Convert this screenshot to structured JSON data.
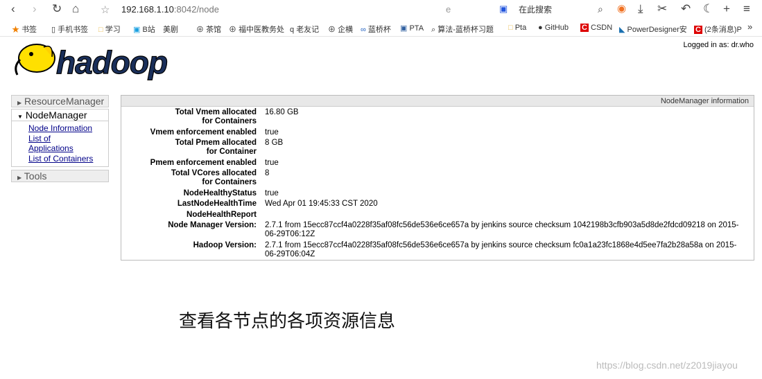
{
  "browser": {
    "url_host": "192.168.1.10",
    "url_rest": ":8042/node",
    "search_placeholder": "在此搜索",
    "bookmarks": [
      "书签",
      "手机书签",
      "学习",
      "B站",
      "美剧",
      "茶馆",
      "福中医教务处",
      "老友记",
      "企横",
      "蓝桥杯",
      "PTA",
      "算法-蓝桥杯习题",
      "Pta",
      "GitHub",
      "CSDN",
      "PowerDesigner安",
      "(2条消息)P"
    ]
  },
  "header": {
    "logo": "hadoop",
    "logged_in": "Logged in as: dr.who"
  },
  "sidebar": {
    "sections": [
      {
        "label": "ResourceManager"
      },
      {
        "label": "NodeManager",
        "items": [
          "Node Information",
          "List of Applications",
          "List of Containers"
        ]
      },
      {
        "label": "Tools"
      }
    ]
  },
  "main": {
    "title": "NodeManager information",
    "rows": [
      {
        "k": "Total Vmem allocated for Containers",
        "v": "16.80 GB"
      },
      {
        "k": "Vmem enforcement enabled",
        "v": "true"
      },
      {
        "k": "Total Pmem allocated for Container",
        "v": "8 GB"
      },
      {
        "k": "Pmem enforcement enabled",
        "v": "true"
      },
      {
        "k": "Total VCores allocated for Containers",
        "v": "8"
      },
      {
        "k": "NodeHealthyStatus",
        "v": "true"
      },
      {
        "k": "LastNodeHealthTime",
        "v": "Wed Apr 01 19:45:33 CST 2020"
      },
      {
        "k": "NodeHealthReport",
        "v": ""
      },
      {
        "k": "Node Manager Version:",
        "v": "2.7.1 from 15ecc87ccf4a0228f35af08fc56de536e6ce657a by jenkins source checksum 1042198b3cfb903a5d8de2fdcd09218 on 2015-06-29T06:12Z"
      },
      {
        "k": "Hadoop Version:",
        "v": "2.7.1 from 15ecc87ccf4a0228f35af08fc56de536e6ce657a by jenkins source checksum fc0a1a23fc1868e4d5ee7fa2b28a58a on 2015-06-29T06:04Z"
      }
    ]
  },
  "caption": "查看各节点的各项资源信息",
  "watermark": "https://blog.csdn.net/z2019jiayou"
}
